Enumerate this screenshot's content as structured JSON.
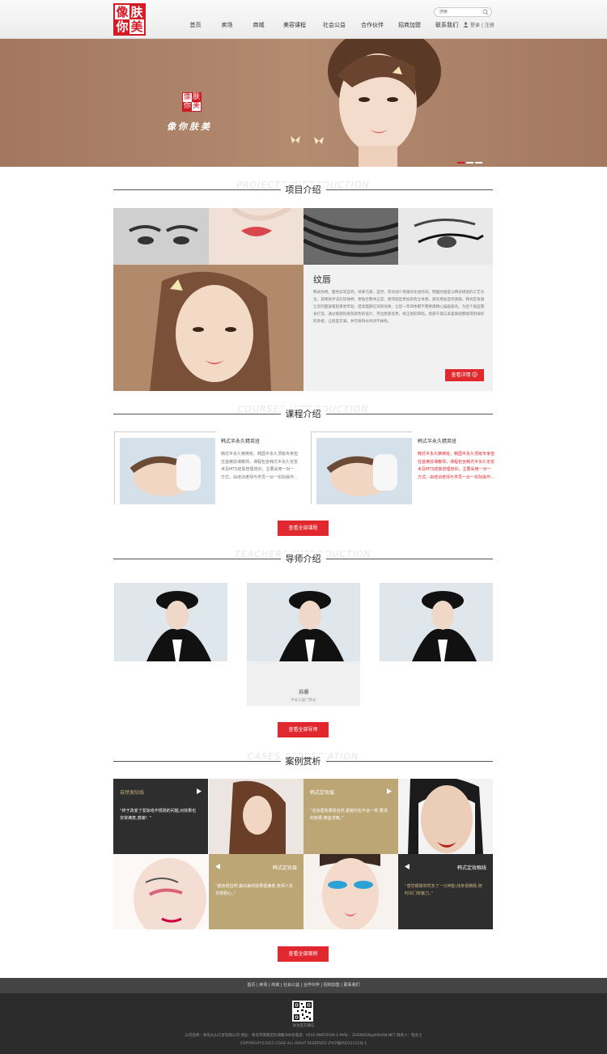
{
  "header": {
    "logo_chars": [
      "像",
      "肤",
      "你",
      "美"
    ],
    "nav": [
      "首页",
      "卖场",
      "商城",
      "美容课程",
      "社会公益",
      "合作伙伴",
      "招商加盟",
      "联系我们"
    ],
    "search_placeholder": "搜索",
    "login": "登录",
    "register": "注册"
  },
  "banner": {
    "logo_chars": [
      "像",
      "肤",
      "你",
      "美"
    ],
    "slogan": "像你肤美",
    "dots": 3,
    "active_dot": 0
  },
  "projects": {
    "title_en": "PROJECTS INTRODUCTION",
    "title_cn": "项目介绍",
    "feature_title": "纹唇",
    "feature_text": "韩式纹绣，面色非常自然，效果乌黑、自然，有效减少草菌的化妆时间。韩国纹眉是以韩式绣眉的工艺为主，其绣眉手法比较独特，更贴合整体五官，使得眉型更加具有立体感，眉毛更加自然柔顺。韩式定妆眉让您的面容看起来更年轻、提高面部红润的效果，让您一年四季都不需要再精心描画眉毛。为您个眉型量身打造，通过唇部轮廓及颜色的设计，突出唇部优势，修正唇形缺陷。唇部干燥与美容质感都能得到很好的改善，让唇型丰满，并可保持长时间不掉色。",
    "detail_button": "查看详情"
  },
  "courses": {
    "title_en": "COURSES INTRODUCTION",
    "title_cn": "课程介绍",
    "items": [
      {
        "title": "韩式半永久精英班",
        "text": "韩式半永久精英班，韩国半永久顶级专家担任首席授课教师，课程包含韩式半永久定妆术及MTS皮肤管理培训，主要采用一对一方式，由培训老师与学员一对一实际操作..."
      },
      {
        "title": "韩式半永久精英班",
        "text": "韩式半永久精英班，韩国半永久顶级专家担任首席授课教师，课程包含韩式半永久定妆术及MTS皮肤管理培训，主要采用一对一方式，由培训老师与学员一对一实际操作..."
      }
    ],
    "all_button": "查看全部课程"
  },
  "teachers": {
    "title_en": "TEACHERS INTRODUCTION",
    "title_cn": "导师介绍",
    "featured_name": "苏珊",
    "featured_role": "半永久部门院长",
    "all_button": "查看全部导师"
  },
  "cases": {
    "title_en": "CASES APPRECIATION",
    "title_cn": "案例赏析",
    "items": [
      {
        "title": "自然发际线",
        "quote": "“终于改变了发际线不规则的问题,对效果也非常满意,感谢！”"
      },
      {
        "title": "韩式定妆眉",
        "quote": "“定妆眉效果很自然,素颜时也不会一样,要求的效果,精益求精。”"
      },
      {
        "title": "韩式定妆眉",
        "quote": "“颜色很自然,做出来的效果很满意,老师人也非常耐心。”"
      },
      {
        "title": "韩式定妆眼线",
        "quote": "“感觉眼睛突然多了一分神韵,线条很精致,随时出门有魅力。”"
      }
    ],
    "all_button": "查看全部案例"
  },
  "footer": {
    "links": "首页 | 卖场 | 商城 | 社会公益 | 合作伙伴 | 招商加盟 | 联系我们",
    "qr_caption": "关注官方微信",
    "company_line": "公司名称：青岛九山工贸有限公司   地址：青岛市南新区科海路368号电话：0532-89655508   E-MAIL：ZHENGDD@9SHAN.NET   联系人：程女士",
    "copyright": "COPYRIGHT©2015 COGE ALL RIGHT RESERVED 沪ICP备05031115号-1"
  },
  "colors": {
    "accent": "#e0282e",
    "banner_bg": "#ab8066",
    "case_gold": "#bca676",
    "case_dark": "#2e2e2e",
    "footer_bg": "#2c2c2c"
  }
}
